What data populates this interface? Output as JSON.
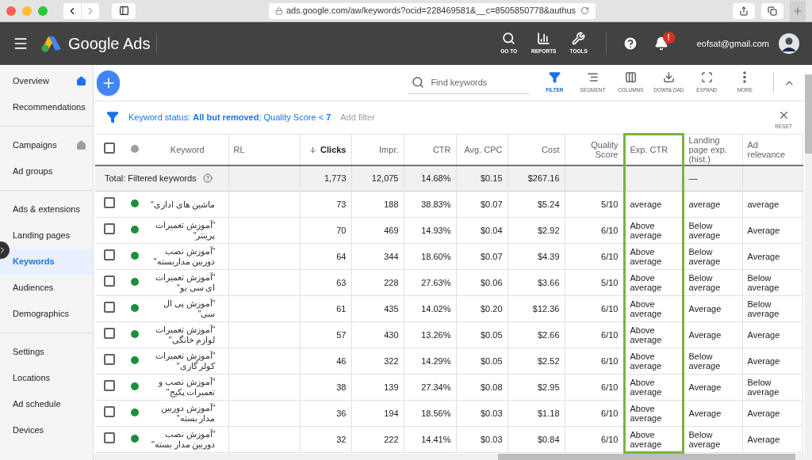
{
  "browser": {
    "url": "ads.google.com/aw/keywords?ocid=228469581&__c=8505850778&authus"
  },
  "header": {
    "product": "Google Ads",
    "nav": [
      {
        "label": "GO TO"
      },
      {
        "label": "REPORTS"
      },
      {
        "label": "TOOLS"
      }
    ],
    "notification_badge": "!",
    "account_email": "eofsat@gmail.com"
  },
  "sidebar": {
    "groups": [
      {
        "items": [
          {
            "label": "Overview",
            "kind": "home-active",
            "selected": false
          },
          {
            "label": "Recommendations",
            "kind": "plain",
            "selected": false
          }
        ]
      },
      {
        "items": [
          {
            "label": "Campaigns",
            "kind": "home",
            "selected": false
          },
          {
            "label": "Ad groups",
            "kind": "plain",
            "selected": false
          }
        ]
      },
      {
        "items": [
          {
            "label": "Ads & extensions",
            "kind": "plain",
            "selected": false
          },
          {
            "label": "Landing pages",
            "kind": "plain",
            "selected": false
          },
          {
            "label": "Keywords",
            "kind": "plain",
            "selected": true
          },
          {
            "label": "Audiences",
            "kind": "plain",
            "selected": false
          },
          {
            "label": "Demographics",
            "kind": "plain",
            "selected": false
          }
        ]
      },
      {
        "items": [
          {
            "label": "Settings",
            "kind": "plain",
            "selected": false
          },
          {
            "label": "Locations",
            "kind": "plain",
            "selected": false
          },
          {
            "label": "Ad schedule",
            "kind": "plain",
            "selected": false
          },
          {
            "label": "Devices",
            "kind": "plain",
            "selected": false
          }
        ]
      }
    ]
  },
  "toolbar": {
    "search_placeholder": "Find keywords",
    "actions": [
      {
        "label": "FILTER",
        "selected": true
      },
      {
        "label": "SEGMENT",
        "selected": false
      },
      {
        "label": "COLUMNS",
        "selected": false
      },
      {
        "label": "DOWNLOAD",
        "selected": false
      },
      {
        "label": "EXPAND",
        "selected": false
      },
      {
        "label": "MORE",
        "selected": false
      }
    ]
  },
  "filter_bar": {
    "summary": "Keyword status: **All but removed**; Quality Score < **7**",
    "add_filter": "Add filter",
    "reset": "RESET"
  },
  "table": {
    "header_checked": false,
    "columns": [
      {
        "label": "Keyword",
        "sorted": false,
        "highlighted": false
      },
      {
        "label": "RL",
        "sorted": false,
        "highlighted": false
      },
      {
        "label": "Clicks",
        "sorted": true,
        "highlighted": false
      },
      {
        "label": "Impr.",
        "sorted": false,
        "highlighted": false
      },
      {
        "label": "CTR",
        "sorted": false,
        "highlighted": false
      },
      {
        "label": "Avg. CPC",
        "sorted": false,
        "highlighted": false
      },
      {
        "label": "Cost",
        "sorted": false,
        "highlighted": false
      },
      {
        "label": "Quality Score",
        "sorted": false,
        "highlighted": false
      },
      {
        "label": "Exp. CTR",
        "sorted": false,
        "highlighted": true
      },
      {
        "label": "Landing page exp. (hist.)",
        "sorted": false,
        "highlighted": false
      },
      {
        "label": "Ad relevance",
        "sorted": false,
        "highlighted": false
      }
    ],
    "total": {
      "cells": [
        "Total: Filtered keywords",
        "",
        "1,773",
        "12,075",
        "14.68%",
        "$0.15",
        "$267.16",
        "",
        "",
        "—",
        ""
      ]
    },
    "rows": [
      {
        "checked": false,
        "color": "#1e8e3e",
        "cells": [
          "ماشین های اداری\"",
          "",
          "73",
          "188",
          "38.83%",
          "$0.07",
          "$5.24",
          "5/10",
          "average",
          "average",
          "average"
        ]
      },
      {
        "checked": false,
        "color": "#1e8e3e",
        "cells": [
          "\"آموزش تعمیرات پرینتر\"",
          "",
          "70",
          "469",
          "14.93%",
          "$0.04",
          "$2.92",
          "6/10",
          "Above average",
          "Below average",
          "Average"
        ]
      },
      {
        "checked": false,
        "color": "#1e8e3e",
        "cells": [
          "\"آموزش نصب دوربین مداربسته\"",
          "",
          "64",
          "344",
          "18.60%",
          "$0.07",
          "$4.39",
          "6/10",
          "Above average",
          "Below average",
          "Average"
        ]
      },
      {
        "checked": false,
        "color": "#1e8e3e",
        "cells": [
          "\"آموزش تعمیرات ای سی یو\"",
          "",
          "63",
          "228",
          "27.63%",
          "$0.06",
          "$3.66",
          "5/10",
          "Above average",
          "Below average",
          "Below average"
        ]
      },
      {
        "checked": false,
        "color": "#1e8e3e",
        "cells": [
          "\"آموزش پی ال سی\"",
          "",
          "61",
          "435",
          "14.02%",
          "$0.20",
          "$12.36",
          "6/10",
          "Above average",
          "Average",
          "Below average"
        ]
      },
      {
        "checked": false,
        "color": "#1e8e3e",
        "cells": [
          "\"آموزش تعمیرات لوازم خانگی\"",
          "",
          "57",
          "430",
          "13.26%",
          "$0.05",
          "$2.66",
          "6/10",
          "Above average",
          "Average",
          "Average"
        ]
      },
      {
        "checked": false,
        "color": "#1e8e3e",
        "cells": [
          "\"آموزش تعمیرات کولر گازی\"",
          "",
          "46",
          "322",
          "14.29%",
          "$0.05",
          "$2.52",
          "6/10",
          "Above average",
          "Below average",
          "Average"
        ]
      },
      {
        "checked": false,
        "color": "#1e8e3e",
        "cells": [
          "\"آموزش نصب و تعمیرات پکیج\"",
          "",
          "38",
          "139",
          "27.34%",
          "$0.08",
          "$2.95",
          "6/10",
          "Above average",
          "Average",
          "Below average"
        ]
      },
      {
        "checked": false,
        "color": "#1e8e3e",
        "cells": [
          "\"آموزش دوربین مدار بسته\"",
          "",
          "36",
          "194",
          "18.56%",
          "$0.03",
          "$1.18",
          "6/10",
          "Above average",
          "Average",
          "Average"
        ]
      },
      {
        "checked": false,
        "color": "#1e8e3e",
        "cells": [
          "\"آموزش نصب دوربین مدار بسته\"",
          "",
          "32",
          "222",
          "14.41%",
          "$0.03",
          "$0.84",
          "6/10",
          "Above average",
          "Below average",
          "Average"
        ]
      }
    ]
  }
}
